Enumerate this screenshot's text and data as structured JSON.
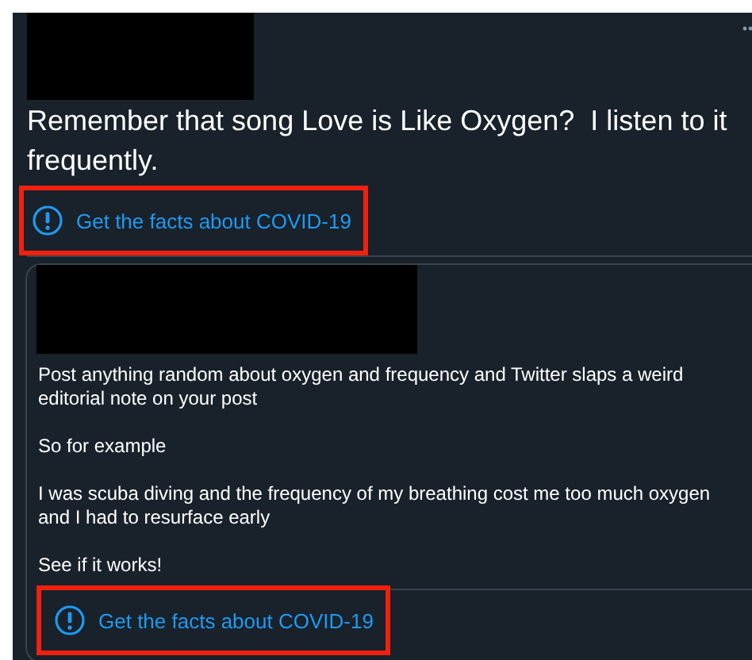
{
  "tweet": {
    "text": "Remember that song Love is Like Oxygen?  I listen to it frequently.",
    "notice": {
      "label": "Get the facts about COVID-19"
    }
  },
  "quoted_tweet": {
    "paragraphs": [
      "Post anything random about oxygen and frequency and Twitter slaps a weird editorial note on your post",
      "So for example",
      "I was scuba diving and the frequency of my breathing cost me too much oxygen and I had to resurface early",
      "See if it works!"
    ],
    "notice": {
      "label": "Get the facts about COVID-19"
    }
  }
}
